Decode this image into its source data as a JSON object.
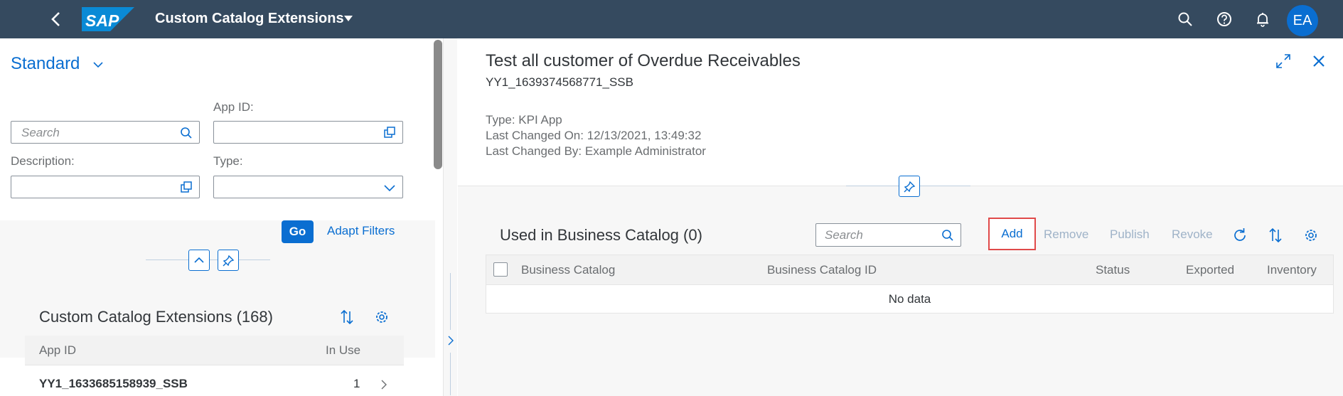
{
  "shell": {
    "title": "Custom Catalog Extensions",
    "logo_text": "SAP",
    "user_initials": "EA",
    "header_color": "#354a5f",
    "icons": [
      "back-icon",
      "search-icon",
      "help-icon",
      "notifications-icon"
    ]
  },
  "filter_bar": {
    "variant": "Standard",
    "search_placeholder": "Search",
    "app_id_label": "App ID:",
    "description_label": "Description:",
    "type_label": "Type:",
    "go_label": "Go",
    "adapt_filters_label": "Adapt Filters"
  },
  "list": {
    "title": "Custom Catalog Extensions (168)",
    "columns": [
      "App ID",
      "In Use"
    ],
    "rows": [
      {
        "app_id": "YY1_1633685158939_SSB",
        "in_use": "1"
      }
    ]
  },
  "detail": {
    "title": "Test all customer of Overdue Receivables",
    "subtitle": "YY1_1639374568771_SSB",
    "type_line": "Type: KPI App",
    "changed_on_line": "Last Changed On: 12/13/2021, 13:49:32",
    "changed_by_line": "Last Changed By: Example Administrator"
  },
  "business_catalog": {
    "title": "Used in Business Catalog (0)",
    "search_placeholder": "Search",
    "add_label": "Add",
    "remove_label": "Remove",
    "publish_label": "Publish",
    "revoke_label": "Revoke",
    "columns": [
      "Business Catalog",
      "Business Catalog ID",
      "Status",
      "Exported",
      "Inventory"
    ],
    "no_data": "No data"
  },
  "colors": {
    "accent": "#0a6ed1",
    "highlight": "#e04a4a",
    "disabled": "#9fb3c8"
  }
}
